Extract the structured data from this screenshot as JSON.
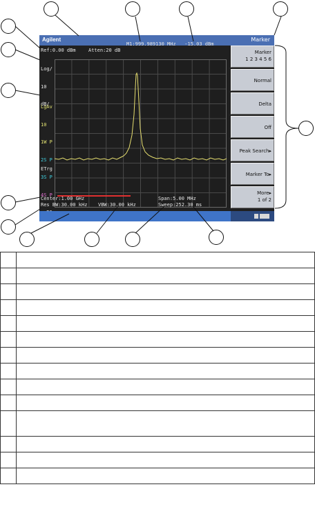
{
  "brand": "Agilent",
  "menu_title": "Marker",
  "readouts": {
    "ref": "Ref:0.00 dBm",
    "atten": "Atten:20 dB",
    "marker": "M1:999.989130 MHz   -15.03 dBm",
    "center": "Center:1.00 GHz",
    "res_bw": "Res BW:30.00 kHz",
    "vbw": "VBW:30.00 kHz",
    "span": "Span:5.00 MHz",
    "sweep": "Sweep:252.30 ms"
  },
  "left_panel": {
    "log": "Log/",
    "scale": "10",
    "unit": "dB/",
    "lgav": "LgAv",
    "avg": "10",
    "t1": "1W P",
    "t2": "2S P",
    "t3": "3S P",
    "t4": "4S P",
    "fc": "FC",
    "etrg": "ETrg"
  },
  "softkeys": [
    {
      "line1": "Marker",
      "line2": "1 2 3 4 5 6"
    },
    {
      "line1": "Normal",
      "line2": ""
    },
    {
      "line1": "Delta",
      "line2": ""
    },
    {
      "line1": "Off",
      "line2": ""
    },
    {
      "line1": "Peak Search▸",
      "line2": ""
    },
    {
      "line1": "Marker To▸",
      "line2": ""
    },
    {
      "line1": "More▸",
      "line2": "1 of 2"
    }
  ],
  "colors": {
    "screen": "#202020",
    "trace": "#e8e070",
    "title_bar": "#4a6fb3",
    "status_bar": "#3f74c8",
    "softkey": "#c8ccd4",
    "trace_label_yellow": "#e0e070",
    "trace_label_cyan": "#40d0e0",
    "trace_label_magenta": "#e070d0"
  }
}
